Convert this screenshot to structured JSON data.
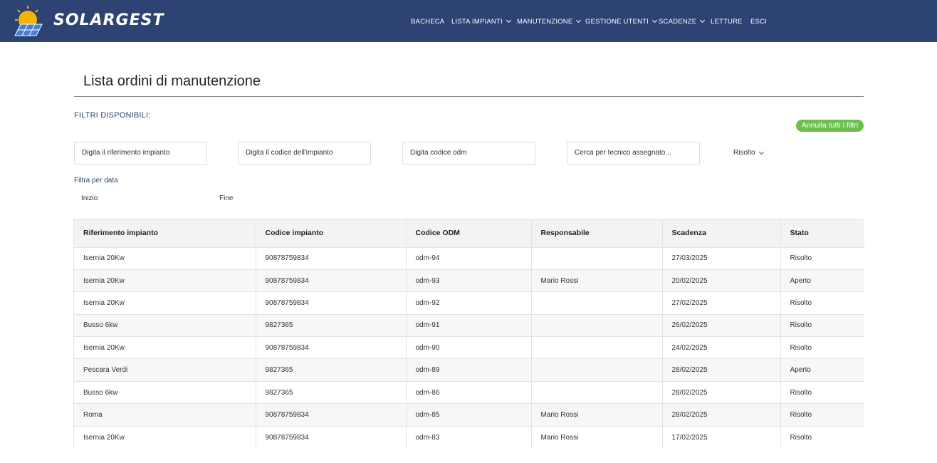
{
  "brand": {
    "name": "SOLARGEST"
  },
  "nav": {
    "bacheca": "BACHECA",
    "lista_impianti": "LISTA IMPIANTI",
    "manutenzione": "MANUTENZIONE",
    "gestione_utenti": "GESTIONE UTENTI",
    "scadenze": "SCADENZE",
    "letture": "LETTURE",
    "esci": "ESCI"
  },
  "page": {
    "title": "Lista ordini di manutenzione"
  },
  "filters": {
    "label": "FILTRI DISPONIBILI:",
    "reset_label": "Annulla tutti i filtri",
    "rif_placeholder": "Digita il riferimento impianto",
    "codice_placeholder": "Digita il codice dell'impianto",
    "odm_placeholder": "Digita codice odm",
    "tecnico_placeholder": "Cerca per tecnico assegnato...",
    "stato_value": "Risolto",
    "date_label": "Filtra per data",
    "inizio_placeholder": "Inizio",
    "fine_placeholder": "Fine"
  },
  "table": {
    "headers": [
      "Riferimento impianto",
      "Codice impianto",
      "Codice ODM",
      "Responsabile",
      "Scadenza",
      "Stato"
    ],
    "rows": [
      [
        "Isernia 20Kw",
        "90878759834",
        "odm-94",
        "",
        "27/03/2025",
        "Risolto"
      ],
      [
        "Isernia 20Kw",
        "90878759834",
        "odm-93",
        "Mario Rossi",
        "20/02/2025",
        "Aperto"
      ],
      [
        "Isernia 20Kw",
        "90878759834",
        "odm-92",
        "",
        "27/02/2025",
        "Risolto"
      ],
      [
        "Busso 6kw",
        "9827365",
        "odm-91",
        "",
        "26/02/2025",
        "Risolto"
      ],
      [
        "Isernia 20Kw",
        "90878759834",
        "odm-90",
        "",
        "24/02/2025",
        "Risolto"
      ],
      [
        "Pescara Verdi",
        "9827365",
        "odm-89",
        "",
        "28/02/2025",
        "Aperto"
      ],
      [
        "Busso 6kw",
        "9827365",
        "odm-86",
        "",
        "28/02/2025",
        "Risolto"
      ],
      [
        "Roma",
        "90878759834",
        "odm-85",
        "Mario Rossi",
        "28/02/2025",
        "Risolto"
      ],
      [
        "Isernia 20Kw",
        "90878759834",
        "odm-83",
        "Mario Rossi",
        "17/02/2025",
        "Risolto"
      ]
    ]
  }
}
